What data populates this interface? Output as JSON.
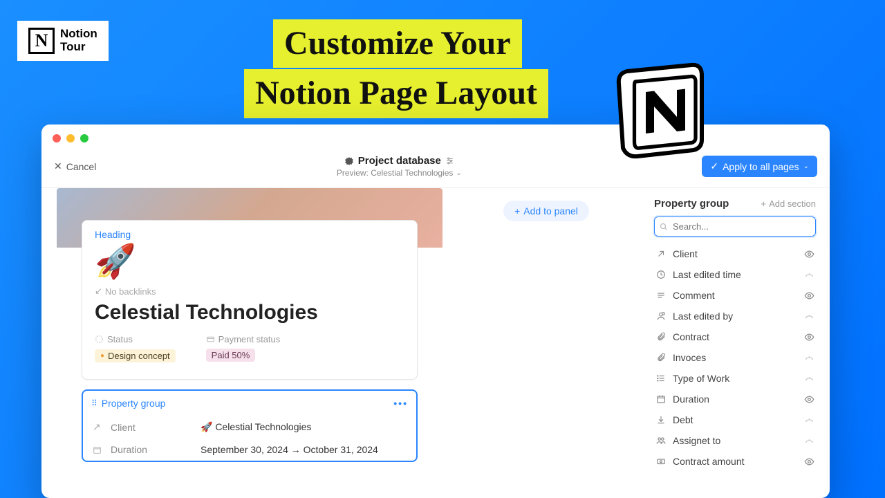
{
  "logo": {
    "letter": "N",
    "text1": "Notion",
    "text2": "Tour"
  },
  "hero": {
    "line1": "Customize Your",
    "line2": "Notion Page Layout"
  },
  "toolbar": {
    "cancel": "Cancel",
    "database_title": "Project database",
    "preview_label": "Preview: Celestial Technologies",
    "apply_label": "Apply to all pages"
  },
  "heading_card": {
    "label": "Heading",
    "no_backlinks": "No backlinks",
    "title": "Celestial Technologies",
    "status_label": "Status",
    "status_value": "Design concept",
    "payment_label": "Payment status",
    "payment_value": "Paid 50%"
  },
  "prop_group_card": {
    "label": "Property group",
    "rows": [
      {
        "key": "Client",
        "value": "🚀 Celestial Technologies"
      },
      {
        "key": "Duration",
        "value": "September 30, 2024 → October 31, 2024"
      }
    ]
  },
  "mid": {
    "add_panel": "Add to panel"
  },
  "right": {
    "title": "Property group",
    "add_section": "Add section",
    "search_placeholder": "Search...",
    "props": [
      {
        "name": "Client",
        "icon": "arrow-up-right",
        "visible": true
      },
      {
        "name": "Last edited time",
        "icon": "clock",
        "visible": false
      },
      {
        "name": "Comment",
        "icon": "lines",
        "visible": true
      },
      {
        "name": "Last edited by",
        "icon": "person-clock",
        "visible": false
      },
      {
        "name": "Contract",
        "icon": "clip",
        "visible": true
      },
      {
        "name": "Invoces",
        "icon": "clip",
        "visible": false
      },
      {
        "name": "Type of Work",
        "icon": "list",
        "visible": false
      },
      {
        "name": "Duration",
        "icon": "calendar",
        "visible": true
      },
      {
        "name": "Debt",
        "icon": "download",
        "visible": false
      },
      {
        "name": "Assignet to",
        "icon": "people",
        "visible": false
      },
      {
        "name": "Contract amount",
        "icon": "money",
        "visible": true
      }
    ]
  }
}
